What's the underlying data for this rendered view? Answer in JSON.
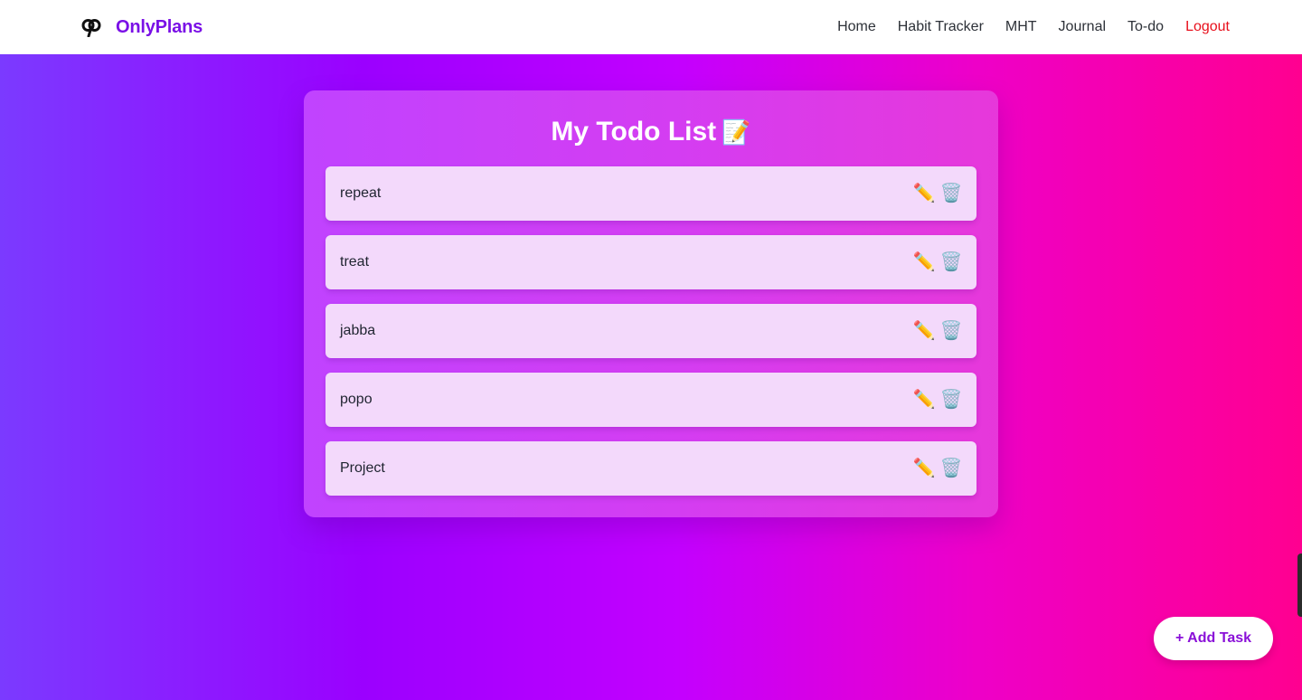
{
  "brand": {
    "name": "OnlyPlans",
    "logo_icon": "brand-logo-icon"
  },
  "nav": {
    "items": [
      {
        "label": "Home"
      },
      {
        "label": "Habit Tracker"
      },
      {
        "label": "MHT"
      },
      {
        "label": "Journal"
      },
      {
        "label": "To-do"
      }
    ],
    "logout_label": "Logout"
  },
  "todo": {
    "title": "My Todo List",
    "title_emoji": "📝",
    "edit_icon": "✏️",
    "delete_icon": "🗑️",
    "items": [
      {
        "text": "repeat"
      },
      {
        "text": "treat"
      },
      {
        "text": "jabba"
      },
      {
        "text": "popo"
      },
      {
        "text": "Project"
      }
    ]
  },
  "add_task_label": "+ Add Task",
  "colors": {
    "brand": "#7a10e6",
    "logout": "#e8101c",
    "item_bg": "#f3d9fb",
    "add_button_text": "#8a10d8"
  }
}
